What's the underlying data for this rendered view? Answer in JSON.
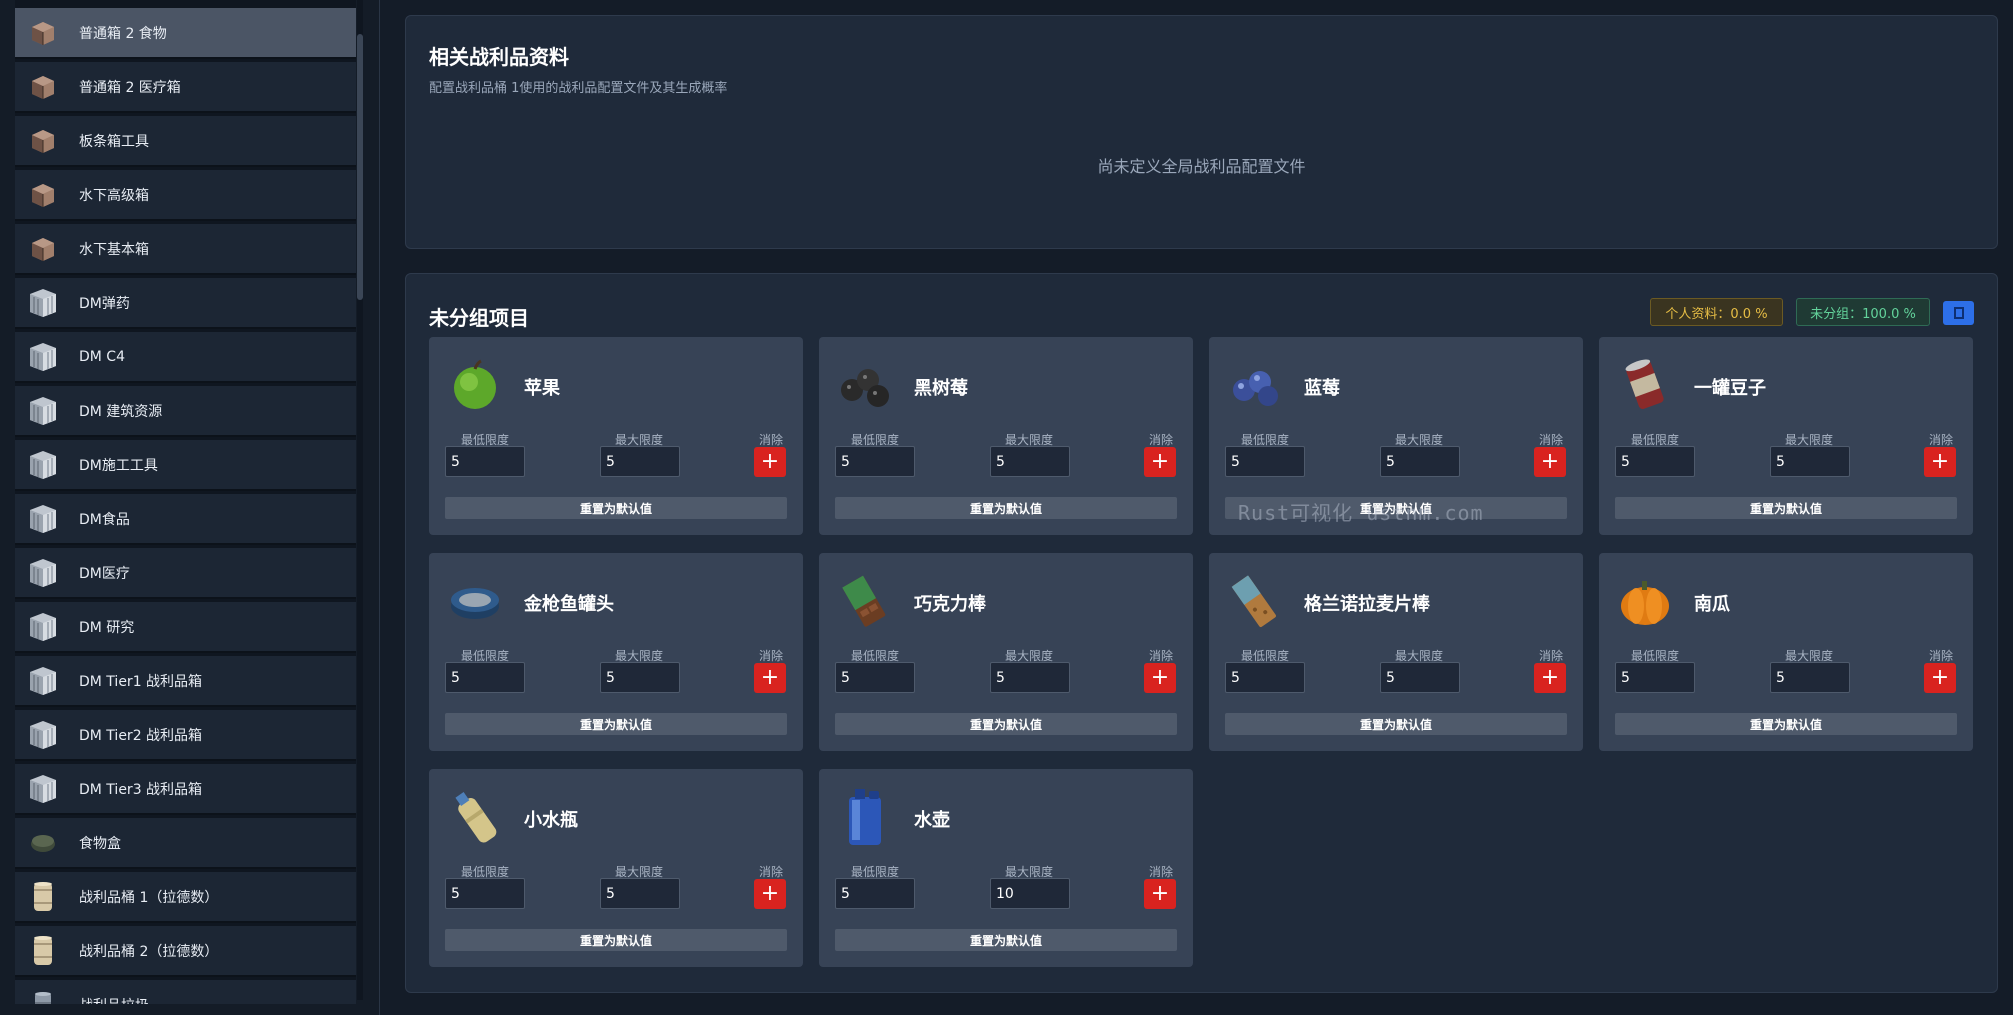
{
  "sidebar": {
    "items": [
      {
        "label": "普通箱 2 食物",
        "icon": "crate-icon",
        "active": true
      },
      {
        "label": "普通箱 2 医疗箱",
        "icon": "crate-icon"
      },
      {
        "label": "板条箱工具",
        "icon": "crate-icon"
      },
      {
        "label": "水下高级箱",
        "icon": "crate-icon"
      },
      {
        "label": "水下基本箱",
        "icon": "crate-icon"
      },
      {
        "label": "DM弹药",
        "icon": "supply-crate-icon"
      },
      {
        "label": "DM C4",
        "icon": "supply-crate-icon"
      },
      {
        "label": "DM 建筑资源",
        "icon": "supply-crate-icon"
      },
      {
        "label": "DM施工工具",
        "icon": "supply-crate-icon"
      },
      {
        "label": "DM食品",
        "icon": "supply-crate-icon"
      },
      {
        "label": "DM医疗",
        "icon": "supply-crate-icon"
      },
      {
        "label": "DM 研究",
        "icon": "supply-crate-icon"
      },
      {
        "label": "DM Tier1 战利品箱",
        "icon": "supply-crate-icon"
      },
      {
        "label": "DM Tier2 战利品箱",
        "icon": "supply-crate-icon"
      },
      {
        "label": "DM Tier3 战利品箱",
        "icon": "supply-crate-icon"
      },
      {
        "label": "食物盒",
        "icon": "food-box-icon"
      },
      {
        "label": "战利品桶 1（拉德数）",
        "icon": "barrel-icon"
      },
      {
        "label": "战利品桶 2（拉德数）",
        "icon": "barrel-icon"
      },
      {
        "label": "战利品垃圾",
        "icon": "trash-can-icon"
      }
    ]
  },
  "profiles_panel": {
    "title": "相关战利品资料",
    "subtitle": "配置战利品桶 1使用的战利品配置文件及其生成概率",
    "empty_message": "尚未定义全局战利品配置文件"
  },
  "ungrouped_panel": {
    "title": "未分组项目",
    "badge_personal": "个人资料：0.0 %",
    "badge_ungrouped": "未分组：100.0 %",
    "colors": {
      "personal": "#e6bd45",
      "ungrouped": "#63d39b",
      "action": "#2d6fe8",
      "delete": "#d9231f"
    }
  },
  "card_labels": {
    "min": "最低限度",
    "max": "最大限度",
    "delete": "消除",
    "reset": "重置为默认值"
  },
  "items": [
    {
      "name": "苹果",
      "icon": "apple-icon",
      "min": "5",
      "max": "5"
    },
    {
      "name": "黑树莓",
      "icon": "blackberry-icon",
      "min": "5",
      "max": "5"
    },
    {
      "name": "蓝莓",
      "icon": "blueberry-icon",
      "min": "5",
      "max": "5"
    },
    {
      "name": "一罐豆子",
      "icon": "bean-can-icon",
      "min": "5",
      "max": "5"
    },
    {
      "name": "金枪鱼罐头",
      "icon": "tuna-can-icon",
      "min": "5",
      "max": "5"
    },
    {
      "name": "巧克力棒",
      "icon": "chocolate-bar-icon",
      "min": "5",
      "max": "5"
    },
    {
      "name": "格兰诺拉麦片棒",
      "icon": "granola-bar-icon",
      "min": "5",
      "max": "5"
    },
    {
      "name": "南瓜",
      "icon": "pumpkin-icon",
      "min": "5",
      "max": "5"
    },
    {
      "name": "小水瓶",
      "icon": "water-bottle-icon",
      "min": "5",
      "max": "5"
    },
    {
      "name": "水壶",
      "icon": "water-jug-icon",
      "min": "5",
      "max": "10"
    }
  ],
  "watermark": "Rust可视化 ustnm.com"
}
